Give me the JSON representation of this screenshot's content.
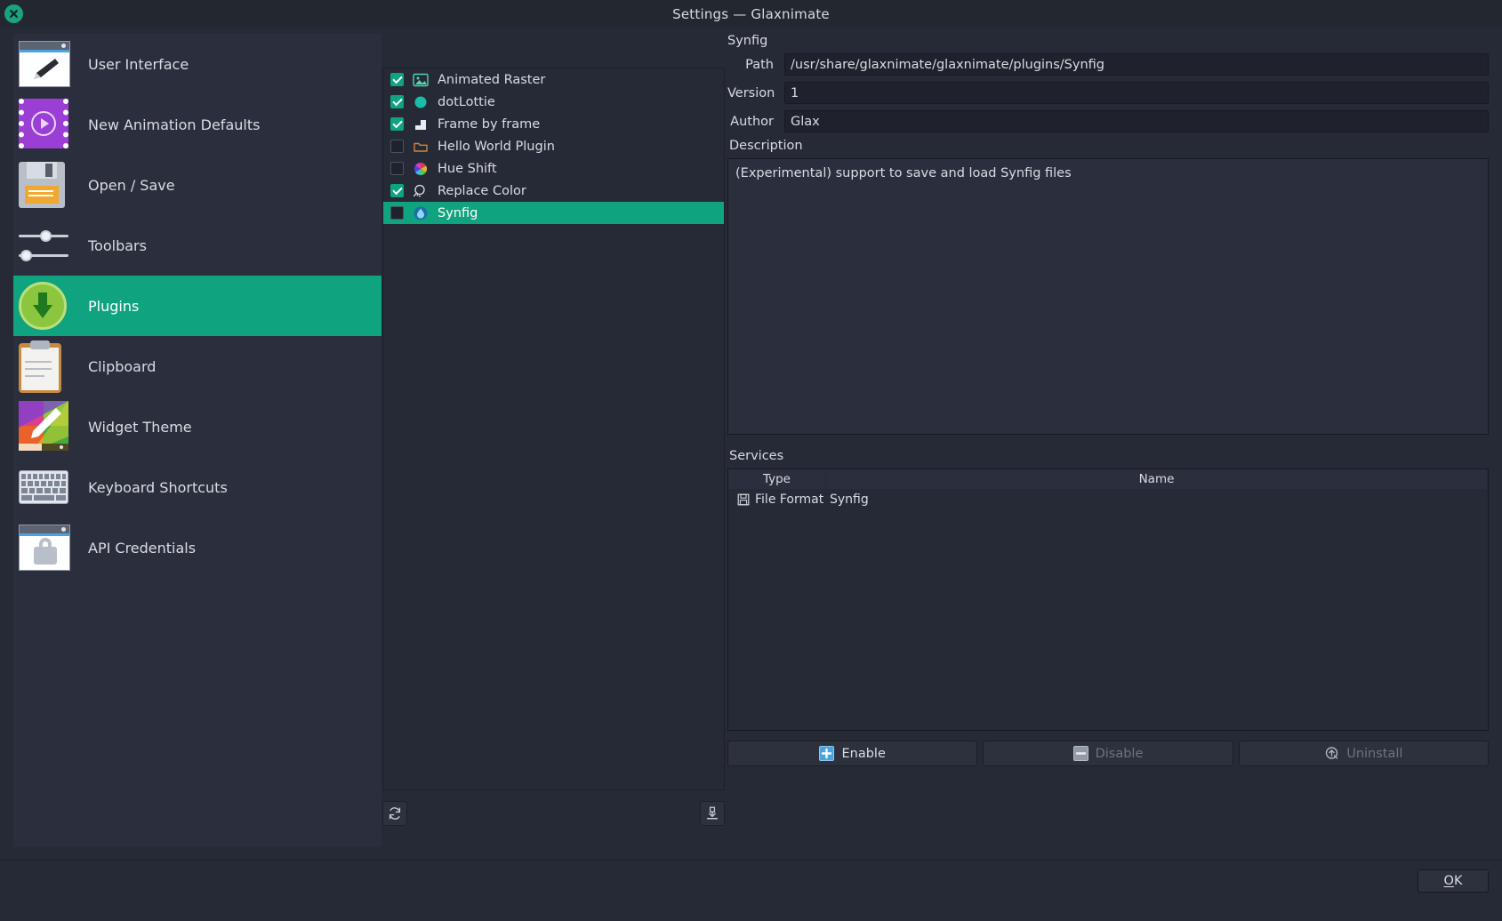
{
  "window": {
    "title": "Settings — Glaxnimate",
    "close_icon": "close-icon"
  },
  "colors": {
    "accent": "#10a37f",
    "window_bg": "#262a36",
    "panel_bg": "#2b2f3d",
    "field_bg": "#1f222c",
    "text": "#d9dce3",
    "text_disabled": "#6d7381",
    "enable_icon": "#4aa3df"
  },
  "sidebar": {
    "items": [
      {
        "label": "User Interface",
        "icon": "paint-window-icon",
        "selected": false
      },
      {
        "label": "New Animation Defaults",
        "icon": "film-play-icon",
        "selected": false
      },
      {
        "label": "Open / Save",
        "icon": "floppy-disk-icon",
        "selected": false
      },
      {
        "label": "Toolbars",
        "icon": "sliders-icon",
        "selected": false
      },
      {
        "label": "Plugins",
        "icon": "download-circle-icon",
        "selected": true
      },
      {
        "label": "Clipboard",
        "icon": "clipboard-icon",
        "selected": false
      },
      {
        "label": "Widget Theme",
        "icon": "color-brush-icon",
        "selected": false
      },
      {
        "label": "Keyboard Shortcuts",
        "icon": "keyboard-icon",
        "selected": false
      },
      {
        "label": "API Credentials",
        "icon": "lock-window-icon",
        "selected": false
      }
    ]
  },
  "plugin_list": {
    "items": [
      {
        "label": "Animated Raster",
        "checked": true,
        "selected": false,
        "icon": "image-icon"
      },
      {
        "label": "dotLottie",
        "checked": true,
        "selected": false,
        "icon": "circle-icon"
      },
      {
        "label": "Frame by frame",
        "checked": true,
        "selected": false,
        "icon": "steps-icon"
      },
      {
        "label": "Hello World Plugin",
        "checked": false,
        "selected": false,
        "icon": "folder-icon"
      },
      {
        "label": "Hue Shift",
        "checked": false,
        "selected": false,
        "icon": "color-wheel-icon"
      },
      {
        "label": "Replace Color",
        "checked": true,
        "selected": false,
        "icon": "magnifier-icon"
      },
      {
        "label": "Synfig",
        "checked": false,
        "selected": true,
        "icon": "synfig-drop-icon"
      }
    ],
    "toolbar": {
      "refresh_icon": "refresh-icon",
      "install_icon": "download-install-icon"
    }
  },
  "details": {
    "plugin_name": "Synfig",
    "path_label": "Path",
    "path_value": "/usr/share/glaxnimate/glaxnimate/plugins/Synfig",
    "version_label": "Version",
    "version_value": "1",
    "author_label": "Author",
    "author_value": "Glax",
    "description_label": "Description",
    "description_value": "(Experimental) support to save and load Synfig files",
    "services_label": "Services",
    "services_columns": [
      "Type",
      "Name"
    ],
    "services_rows": [
      {
        "type": "File Format",
        "name": "Synfig",
        "icon": "save-icon"
      }
    ],
    "actions": [
      {
        "label": "Enable",
        "icon": "plus-icon",
        "disabled": false
      },
      {
        "label": "Disable",
        "icon": "minus-icon",
        "disabled": true
      },
      {
        "label": "Uninstall",
        "icon": "uninstall-icon",
        "disabled": true
      }
    ]
  },
  "footer": {
    "ok_mnemonic": "O",
    "ok_rest": "K"
  }
}
